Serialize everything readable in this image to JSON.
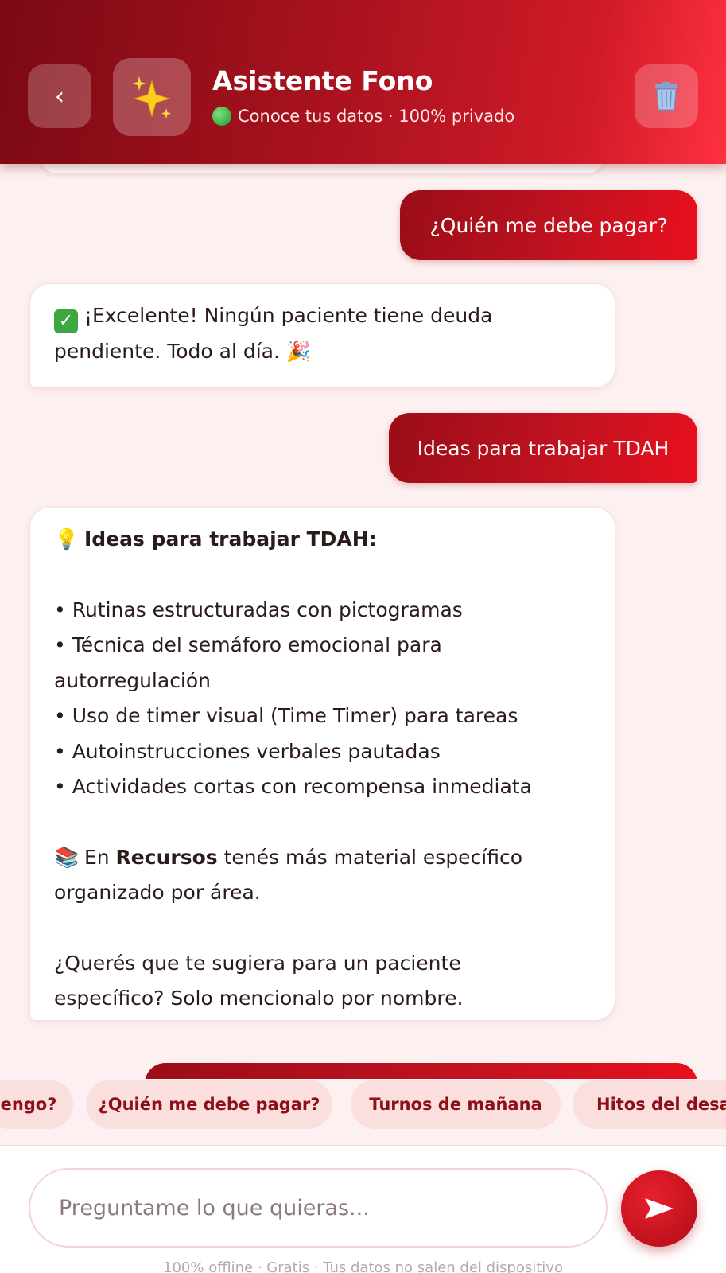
{
  "header": {
    "title": "Asistente Fono",
    "subtitle": "Conoce tus datos · 100% privado",
    "back_icon": "‹"
  },
  "messages": [
    {
      "role": "user",
      "text": "¿Quién me debe pagar?"
    },
    {
      "role": "bot",
      "lines": [
        "¡Excelente! Ningún paciente tiene deuda",
        "pendiente. Todo al día."
      ]
    },
    {
      "role": "user",
      "text": "Ideas para trabajar TDAH"
    },
    {
      "role": "bot",
      "heading": "Ideas para trabajar TDAH:",
      "bullets": [
        "• Rutinas estructuradas con pictogramas",
        "• Técnica del semáforo emocional para",
        "autorregulación",
        "• Uso de timer visual (Time Timer) para tareas",
        "• Autoinstrucciones verbales pautadas",
        "• Actividades cortas con recompensa inmediata"
      ],
      "resources_pre": "En",
      "resources_bold": "Recursos",
      "resources_post": "tenés más material específico",
      "resources_line2": "organizado por área.",
      "question_line1": "¿Querés que te sugiera para un paciente",
      "question_line2": "específico? Solo mencionalo por nombre."
    }
  ],
  "chips": [
    "engo?",
    "¿Quién me debe pagar?",
    "Turnos de mañana",
    "Hitos del desar"
  ],
  "input": {
    "placeholder": "Preguntame lo que quieras..."
  },
  "footer": "100% offline · Gratis · Tus datos no salen del dispositivo",
  "colors": {
    "brand_dark": "#7a0a14",
    "brand": "#c41220",
    "chip_bg": "#fbdede",
    "chip_text": "#8c0f1a"
  }
}
